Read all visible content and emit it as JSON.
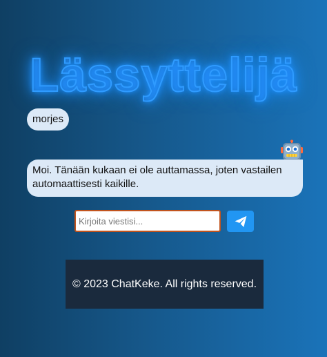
{
  "app": {
    "title": "Lässyttelijä"
  },
  "chat": {
    "messages": [
      {
        "sender": "user",
        "text": "morjes"
      },
      {
        "sender": "bot",
        "text": "Moi. Tänään kukaan ei ole auttamassa, joten vastailen automaattisesti kaikille."
      }
    ],
    "bot_avatar_icon": "robot-icon"
  },
  "composer": {
    "placeholder": "Kirjoita viestisi...",
    "value": "",
    "send_icon": "paper-plane-icon",
    "send_button_color": "#2196f3",
    "input_border_color": "#c2541d"
  },
  "footer": {
    "text": "© 2023 ChatKeke. All rights reserved."
  },
  "colors": {
    "background_left": "#0f3f63",
    "background_right": "#1a73b9",
    "title_glow": "#1e90ff",
    "bubble": "#dce9f7",
    "footer_background": "#1a2a3d"
  }
}
